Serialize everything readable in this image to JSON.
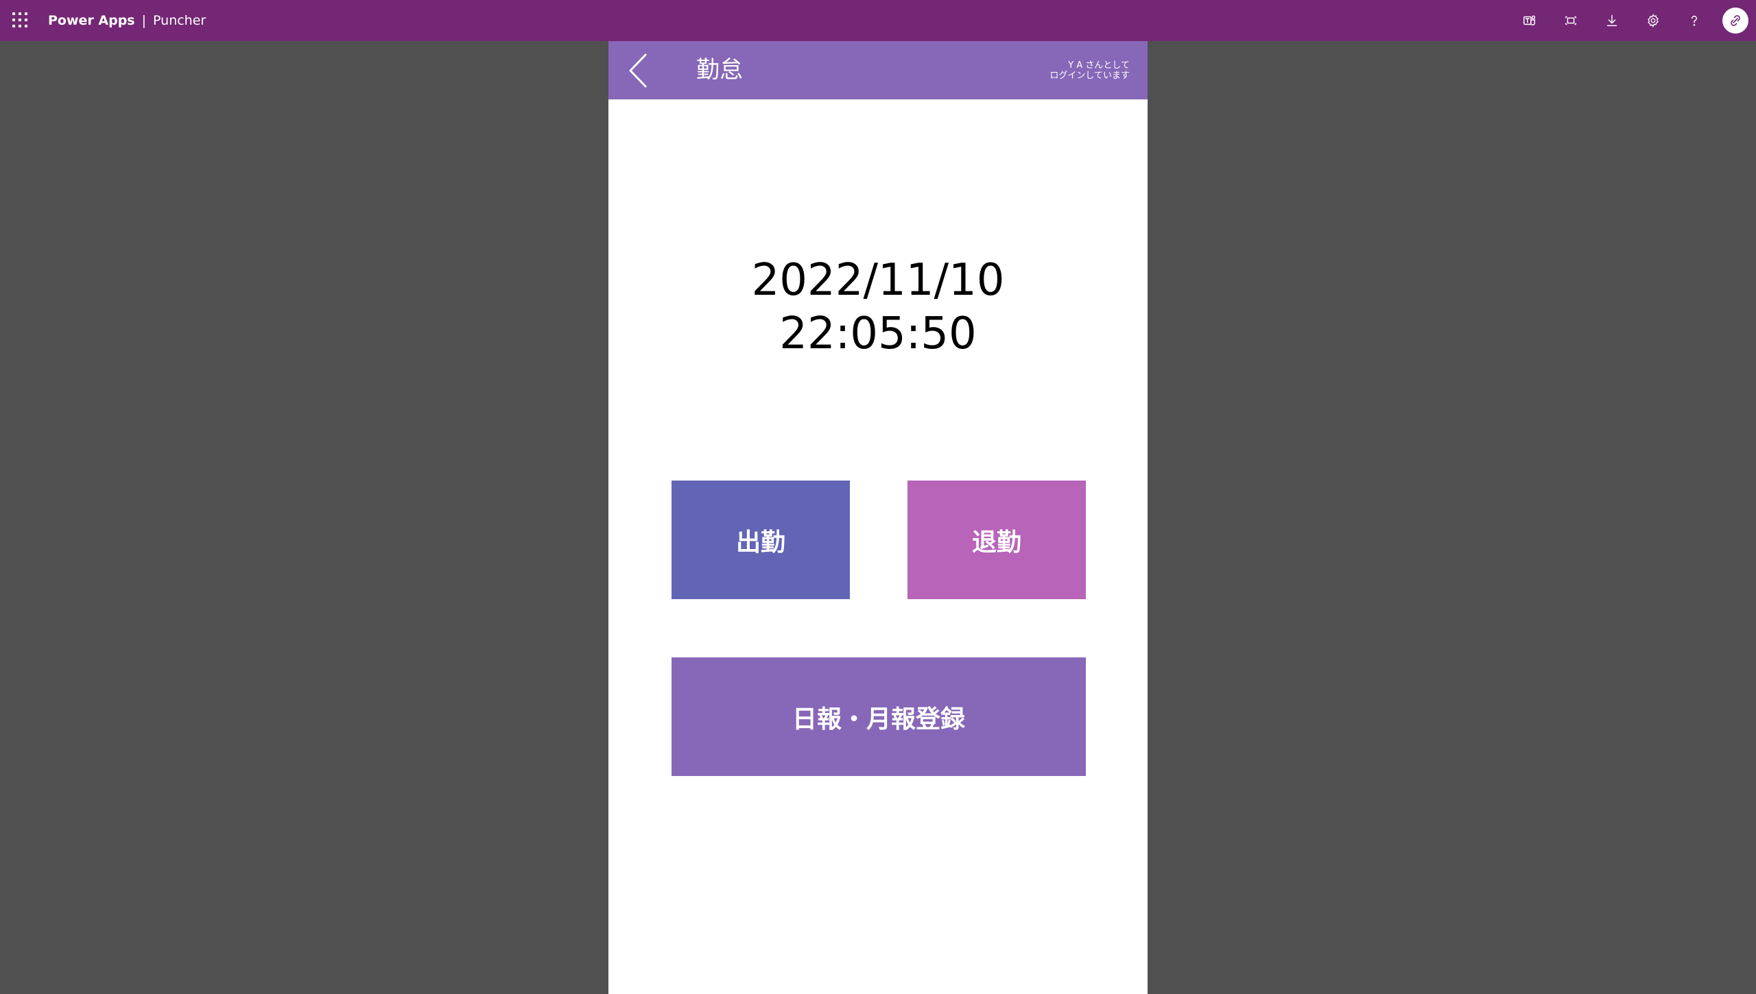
{
  "topbar": {
    "brand": "Power Apps",
    "separator": "|",
    "app_name": "Puncher",
    "background": "#742774",
    "actions": [
      {
        "name": "teams-icon"
      },
      {
        "name": "fullscreen-icon"
      },
      {
        "name": "download-icon"
      },
      {
        "name": "gear-icon"
      },
      {
        "name": "help-icon"
      }
    ]
  },
  "app": {
    "header": {
      "title": "勤怠",
      "login_line1": "Y A さんとして",
      "login_line2": "ログインしています",
      "background": "#8767b8"
    },
    "date": "2022/11/10",
    "time": "22:05:50",
    "buttons": {
      "clock_in": "出勤",
      "clock_out": "退勤",
      "report": "日報・月報登録"
    },
    "colors": {
      "clock_in": "#6264b5",
      "clock_out": "#b764b9",
      "report": "#8767b8"
    }
  }
}
